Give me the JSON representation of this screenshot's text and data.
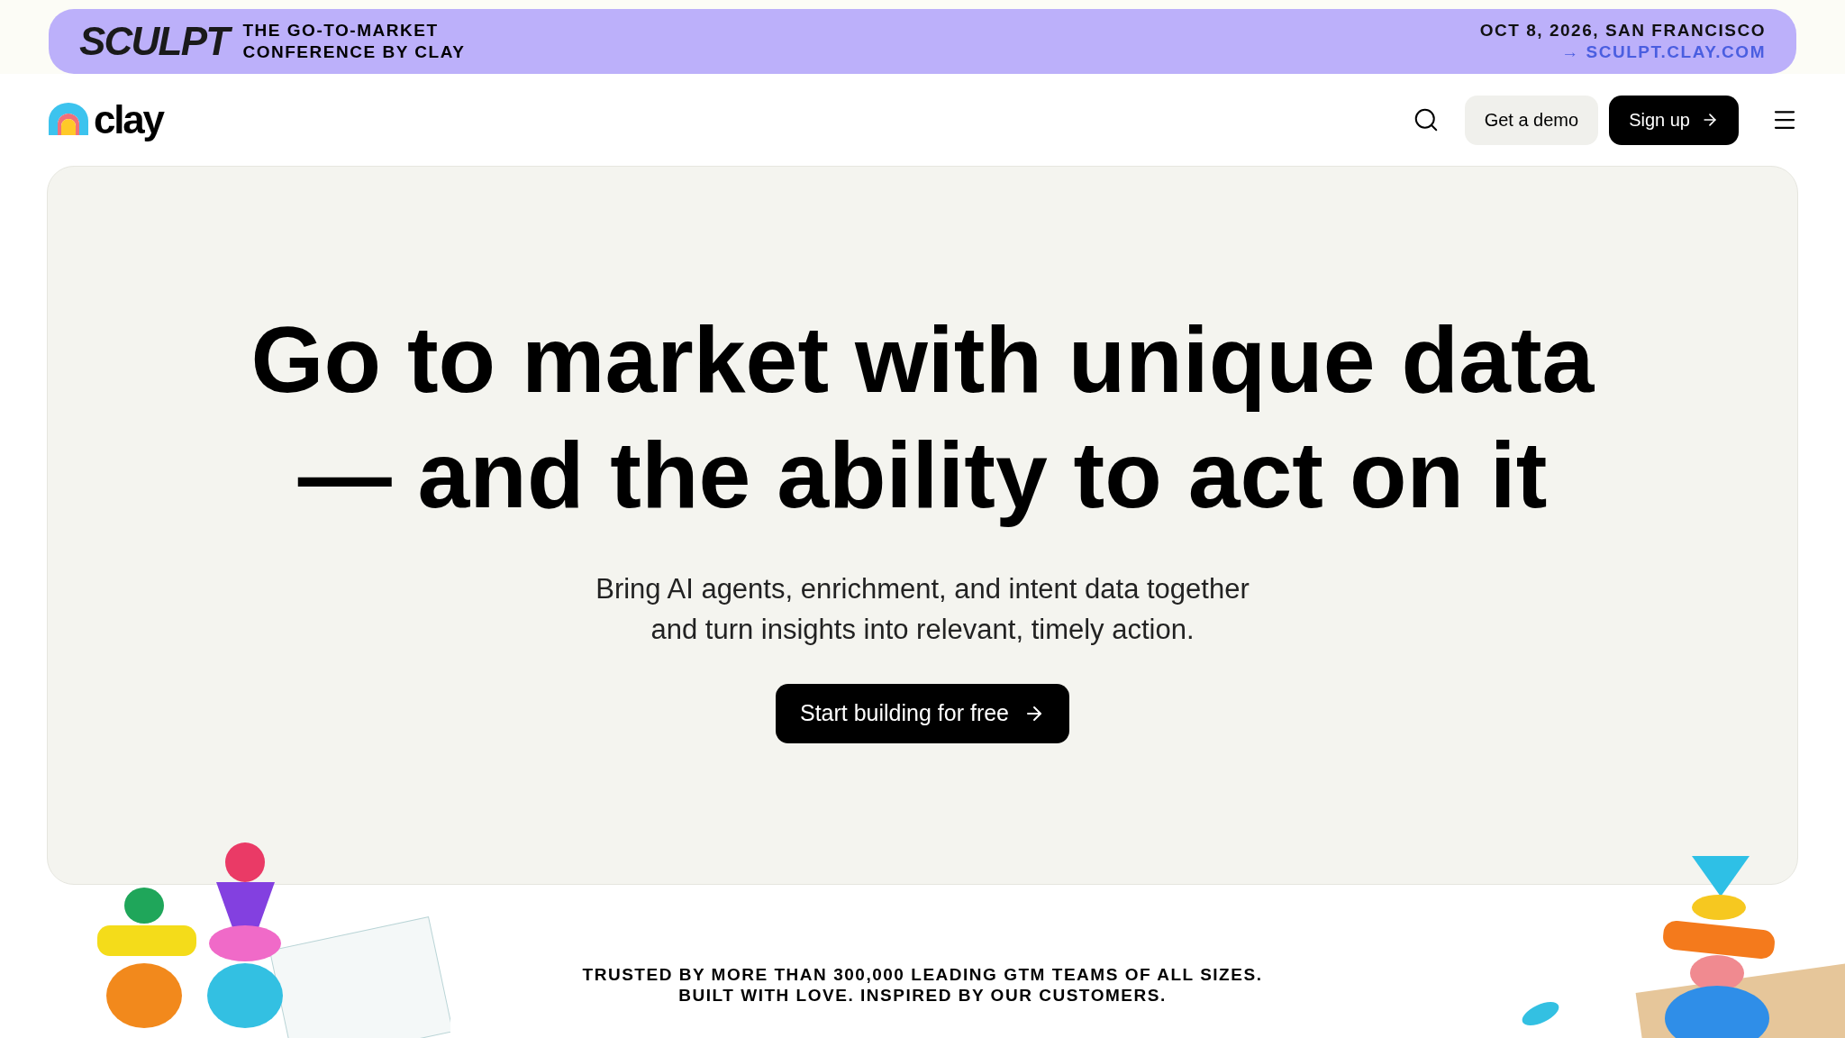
{
  "banner": {
    "logo": "SCULPT",
    "tagline_lines": [
      "THE GO-TO-MARKET",
      "CONFERENCE BY CLAY"
    ],
    "date": "OCT 8, 2026, SAN FRANCISCO",
    "link": "→ SCULPT.CLAY.COM"
  },
  "nav": {
    "brand": "clay",
    "buttons": [
      {
        "label": "Get a demo",
        "kind": "secondary"
      },
      {
        "label": "Sign up",
        "kind": "primary"
      }
    ]
  },
  "hero": {
    "headline_lines": [
      "Go to market with unique data",
      "— and the ability to act on it"
    ],
    "subtitle_lines": [
      "Bring AI agents, enrichment, and intent data together",
      "and turn insights into relevant, timely action."
    ],
    "cta": "Start building for free"
  },
  "trust": {
    "lines": [
      "TRUSTED BY MORE THAN 300,000 LEADING GTM TEAMS OF ALL SIZES.",
      "BUILT WITH LOVE. INSPIRED BY OUR CUSTOMERS."
    ]
  }
}
